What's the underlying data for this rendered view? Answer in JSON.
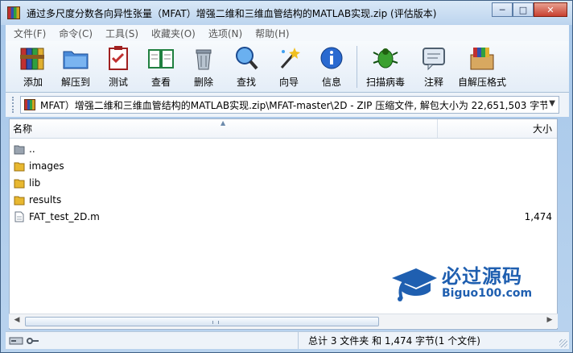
{
  "window": {
    "title": "通过多尺度分数各向异性张量（MFAT）增强二维和三维血管结构的MATLAB实现.zip (评估版本)",
    "controls": {
      "minimize": "─",
      "maximize": "□",
      "close": "✕"
    }
  },
  "menu": [
    "文件(F)",
    "命令(C)",
    "工具(S)",
    "收藏夹(O)",
    "选项(N)",
    "帮助(H)"
  ],
  "toolbar": {
    "group1": [
      {
        "label": "添加",
        "icon": "archive-books-icon"
      },
      {
        "label": "解压到",
        "icon": "folder-extract-icon"
      },
      {
        "label": "测试",
        "icon": "clipboard-check-icon"
      },
      {
        "label": "查看",
        "icon": "open-book-icon"
      },
      {
        "label": "删除",
        "icon": "trash-can-icon"
      },
      {
        "label": "查找",
        "icon": "magnifier-icon"
      },
      {
        "label": "向导",
        "icon": "magic-wand-icon"
      },
      {
        "label": "信息",
        "icon": "info-icon"
      }
    ],
    "group2": [
      {
        "label": "扫描病毒",
        "icon": "bug-icon"
      },
      {
        "label": "注释",
        "icon": "comment-icon"
      },
      {
        "label": "自解压格式",
        "icon": "sfx-box-icon"
      }
    ]
  },
  "address": {
    "path": "MFAT）增强二维和三维血管结构的MATLAB实现.zip\\MFAT-master\\2D - ZIP 压缩文件, 解包大小为 22,651,503 字节"
  },
  "columns": {
    "name": "名称",
    "size": "大小"
  },
  "files": [
    {
      "name": "..",
      "size": "",
      "type": "parent"
    },
    {
      "name": "images",
      "size": "",
      "type": "folder"
    },
    {
      "name": "lib",
      "size": "",
      "type": "folder"
    },
    {
      "name": "results",
      "size": "",
      "type": "folder"
    },
    {
      "name": "FAT_test_2D.m",
      "size": "1,474",
      "type": "file"
    }
  ],
  "watermark": {
    "cn": "必过源码",
    "en": "Biguo100.com"
  },
  "status": {
    "text": "总计 3 文件夹 和 1,474 字节(1 个文件)"
  },
  "colors": {
    "accent": "#1f5fb0",
    "folder": "#e8b830",
    "window_frame": "#a8c8ea"
  }
}
